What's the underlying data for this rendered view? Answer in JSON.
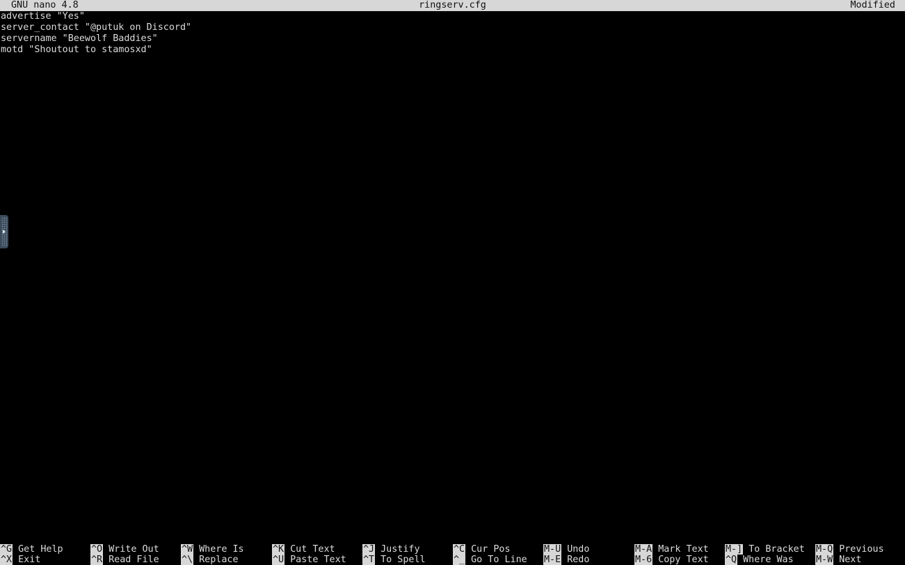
{
  "titlebar": {
    "app": "GNU nano 4.8",
    "filename": "ringserv.cfg",
    "status": "Modified"
  },
  "editor": {
    "lines": [
      "advertise \"Yes\"",
      "server_contact \"@putuk on Discord\"",
      "servername \"Beewolf Baddies\"",
      "motd \"Shoutout to stamosxd\""
    ]
  },
  "shortcuts": {
    "row1": [
      {
        "key": "^G",
        "label": "Get Help"
      },
      {
        "key": "^O",
        "label": "Write Out"
      },
      {
        "key": "^W",
        "label": "Where Is"
      },
      {
        "key": "^K",
        "label": "Cut Text"
      },
      {
        "key": "^J",
        "label": "Justify"
      },
      {
        "key": "^C",
        "label": "Cur Pos"
      },
      {
        "key": "M-U",
        "label": "Undo"
      },
      {
        "key": "M-A",
        "label": "Mark Text"
      },
      {
        "key": "M-]",
        "label": "To Bracket"
      },
      {
        "key": "M-Q",
        "label": "Previous"
      }
    ],
    "row2": [
      {
        "key": "^X",
        "label": "Exit"
      },
      {
        "key": "^R",
        "label": "Read File"
      },
      {
        "key": "^\\",
        "label": "Replace"
      },
      {
        "key": "^U",
        "label": "Paste Text"
      },
      {
        "key": "^T",
        "label": "To Spell"
      },
      {
        "key": "^_",
        "label": "Go To Line"
      },
      {
        "key": "M-E",
        "label": "Redo"
      },
      {
        "key": "M-6",
        "label": "Copy Text"
      },
      {
        "key": "^Q",
        "label": "Where Was"
      },
      {
        "key": "M-W",
        "label": "Next"
      }
    ]
  },
  "colors": {
    "background": "#000000",
    "bar": "#d7d7d7",
    "text": "#dcdcdc"
  },
  "side_handle": {
    "icon": "expand-arrow-icon"
  }
}
